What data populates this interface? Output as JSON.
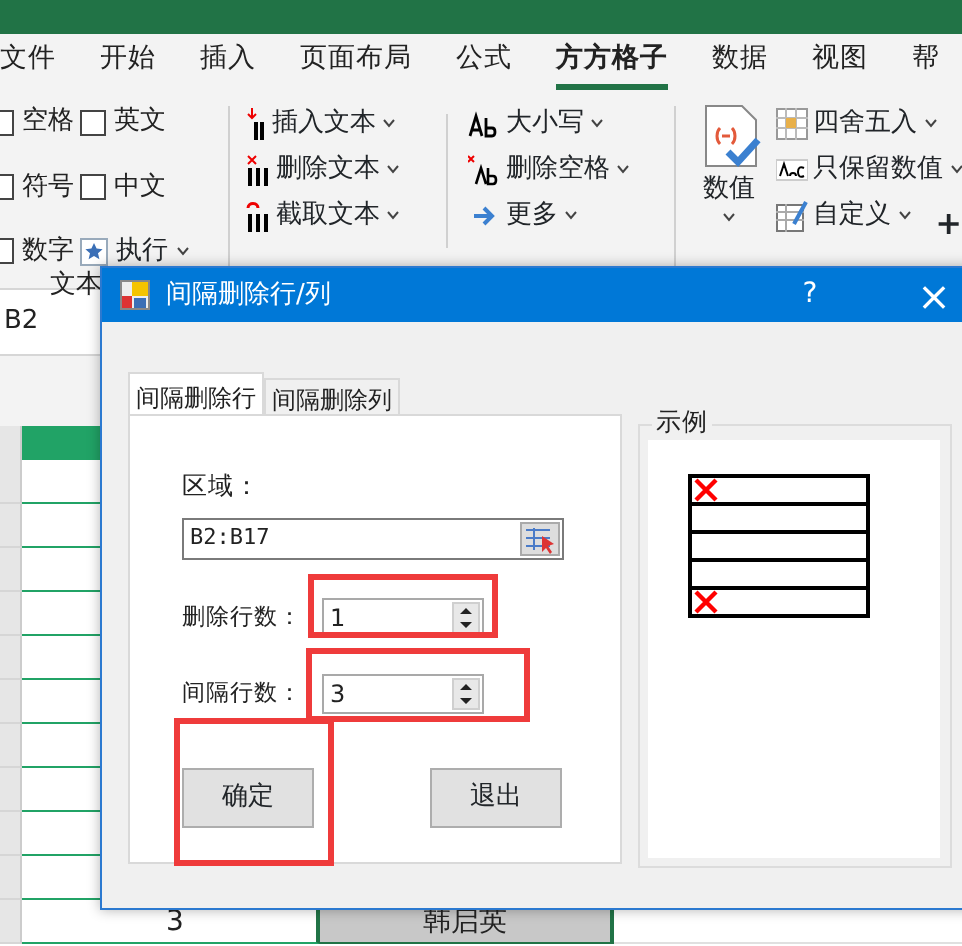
{
  "ribbon_tabs": [
    {
      "label": "文件",
      "selected": false
    },
    {
      "label": "开始",
      "selected": false
    },
    {
      "label": "插入",
      "selected": false
    },
    {
      "label": "页面布局",
      "selected": false
    },
    {
      "label": "公式",
      "selected": false
    },
    {
      "label": "方方格子",
      "selected": true
    },
    {
      "label": "数据",
      "selected": false
    },
    {
      "label": "视图",
      "selected": false
    },
    {
      "label": "帮",
      "selected": false
    }
  ],
  "checkboxes": [
    {
      "label": "空格",
      "checked": false
    },
    {
      "label": "英文",
      "checked": false
    },
    {
      "label": "符号",
      "checked": false
    },
    {
      "label": "中文",
      "checked": false
    },
    {
      "label": "数字",
      "checked": false
    }
  ],
  "run_button": "执行",
  "text_commands": [
    {
      "label": "插入文本",
      "kind": "insert"
    },
    {
      "label": "删除文本",
      "kind": "delete"
    },
    {
      "label": "截取文本",
      "kind": "cut"
    }
  ],
  "case_commands": [
    {
      "label": "大小写",
      "kind": "case"
    },
    {
      "label": "删除空格",
      "kind": "space"
    },
    {
      "label": "更多",
      "kind": "more"
    }
  ],
  "number_button": "数值",
  "number_commands": [
    {
      "label": "四舍五入",
      "kind": "round"
    },
    {
      "label": "只保留数值",
      "kind": "values"
    },
    {
      "label": "自定义",
      "kind": "custom"
    }
  ],
  "plus_button": "+",
  "group_label": "文本",
  "name_box": "B2",
  "sheet_rows": [
    {
      "col_1": "3",
      "col_2": "韩启英"
    }
  ],
  "dialog": {
    "title": "间隔删除行/列",
    "help": "?",
    "close": "×",
    "tabs": [
      {
        "label": "间隔删除行",
        "selected": true
      },
      {
        "label": "间隔删除列",
        "selected": false
      }
    ],
    "range_label": "区域：",
    "range_value": "B2:B17",
    "delete_label": "删除行数：",
    "delete_value": "1",
    "interval_label": "间隔行数：",
    "interval_value": "3",
    "ok_button": "确定",
    "exit_button": "退出",
    "example_title": "示例",
    "example_rows": [
      {
        "marked": true
      },
      {
        "marked": false
      },
      {
        "marked": false
      },
      {
        "marked": false
      },
      {
        "marked": true
      }
    ]
  }
}
